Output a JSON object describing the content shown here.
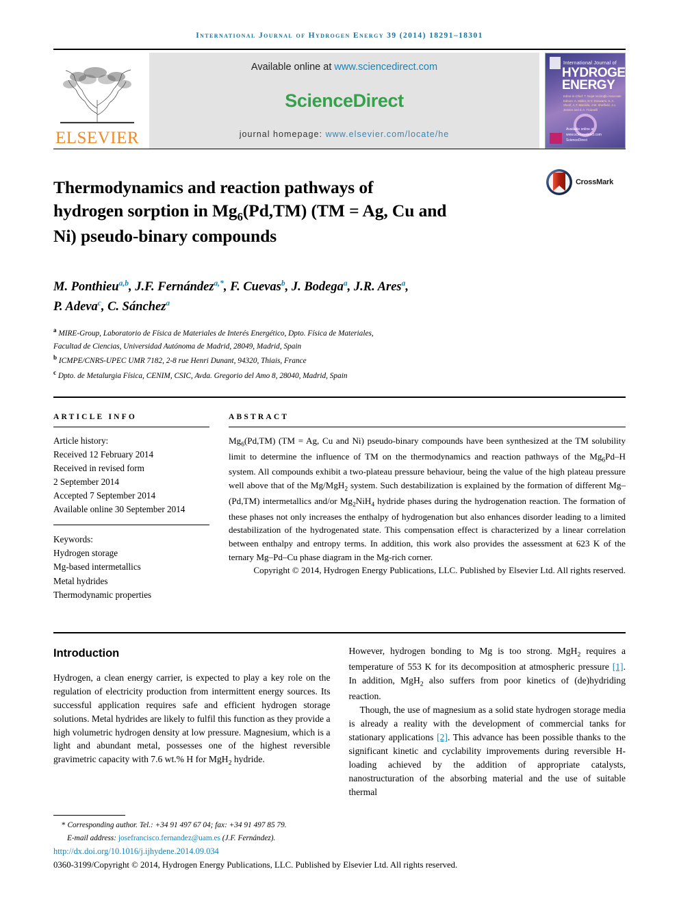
{
  "running_head": "International Journal of Hydrogen Energy 39 (2014) 18291–18301",
  "masthead": {
    "publisher": "ELSEVIER",
    "available_prefix": "Available online at ",
    "available_url": "www.sciencedirect.com",
    "sciencedirect_logo": "ScienceDirect",
    "homepage_prefix": "journal homepage: ",
    "homepage_url": "www.elsevier.com/locate/he",
    "cover": {
      "line1": "International Journal of",
      "line2": "HYDROGEN",
      "line3": "ENERGY",
      "editors": "Editor-in-Chief: T. Nejat Veziroğlu\nAssociate Editors: A. Müller, D.Y. Goswami, S. A. Sherif,\nA.T. Marolda, J.W. Sheffield,\nJ.o. Jensen and E.A. Ticianelli",
      "sciencedirect_note": "Available online at www.sciencedirect.com\nScienceDirect"
    }
  },
  "crossmark": {
    "label": "CrossMark"
  },
  "article": {
    "title_line1": "Thermodynamics and reaction pathways of",
    "title_line2_a": "hydrogen sorption in Mg",
    "title_line2_sub": "6",
    "title_line2_b": "(Pd,TM) (TM = Ag, Cu and",
    "title_line3": "Ni) pseudo-binary compounds"
  },
  "authors": {
    "list": [
      {
        "name": "M. Ponthieu",
        "sup": "a,b",
        "sep": ", "
      },
      {
        "name": "J.F. Fernández",
        "sup": "a,*",
        "sep": ", "
      },
      {
        "name": "F. Cuevas",
        "sup": "b",
        "sep": ", "
      },
      {
        "name": "J. Bodega",
        "sup": "a",
        "sep": ", "
      },
      {
        "name": "J.R. Ares",
        "sup": "a",
        "sep": ", "
      },
      {
        "name": "P. Adeva",
        "sup": "c",
        "sep": ", "
      },
      {
        "name": "C. Sánchez",
        "sup": "a",
        "sep": ""
      }
    ],
    "affiliations": [
      {
        "marker": "a",
        "text": "MIRE-Group, Laboratorio de Física de Materiales de Interés Energético, Dpto. Física de Materiales,"
      },
      {
        "marker": "",
        "text": "Facultad de Ciencias, Universidad Autónoma de Madrid, 28049, Madrid, Spain"
      },
      {
        "marker": "b",
        "text": "ICMPE/CNRS-UPEC UMR 7182, 2-8 rue Henri Dunant, 94320, Thiais, France"
      },
      {
        "marker": "c",
        "text": "Dpto. de Metalurgia Física, CENIM, CSIC, Avda. Gregorio del Amo 8, 28040, Madrid, Spain"
      }
    ]
  },
  "article_info": {
    "heading": "ARTICLE INFO",
    "history_label": "Article history:",
    "history": [
      "Received 12 February 2014",
      "Received in revised form",
      "2 September 2014",
      "Accepted 7 September 2014",
      "Available online 30 September 2014"
    ],
    "keywords_label": "Keywords:",
    "keywords": [
      "Hydrogen storage",
      "Mg-based intermetallics",
      "Metal hydrides",
      "Thermodynamic properties"
    ]
  },
  "abstract": {
    "heading": "ABSTRACT",
    "p1_a": "Mg",
    "p1_sub1": "6",
    "p1_b": "(Pd,TM) (TM = Ag, Cu and Ni) pseudo-binary compounds have been synthesized at the TM solubility limit to determine the influence of TM on the thermodynamics and reaction pathways of the Mg",
    "p1_sub2": "6",
    "p1_c": "Pd–H system. All compounds exhibit a two-plateau pressure behaviour, being the value of the high plateau pressure well above that of the Mg/MgH",
    "p1_sub3": "2",
    "p1_d": " system. Such destabilization is explained by the formation of different Mg–(Pd,TM) intermetallics and/or Mg",
    "p1_sub4": "2",
    "p1_e": "NiH",
    "p1_sub5": "4",
    "p1_f": " hydride phases during the hydrogenation reaction. The formation of these phases not only increases the enthalpy of hydrogenation but also enhances disorder leading to a limited destabilization of the hydrogenated state. This compensation effect is characterized by a linear correlation between enthalpy and entropy terms. In addition, this work also provides the assessment at 623 K of the ternary Mg–Pd–Cu phase diagram in the Mg-rich corner.",
    "copyright": "Copyright © 2014, Hydrogen Energy Publications, LLC. Published by Elsevier Ltd. All rights reserved."
  },
  "body": {
    "heading": "Introduction",
    "left_p1": "Hydrogen, a clean energy carrier, is expected to play a key role on the regulation of electricity production from intermittent energy sources. Its successful application requires safe and efficient hydrogen storage solutions. Metal hydrides are likely to fulfil this function as they provide a high volumetric hydrogen density at low pressure. Magnesium, which is a light and abundant metal, possesses one of the highest reversible gravimetric capacity with 7.6 wt.% H for MgH",
    "left_p1_sub": "2",
    "left_p1_end": " hydride.",
    "right_p1_a": "However, hydrogen bonding to Mg is too strong. MgH",
    "right_p1_sub1": "2",
    "right_p1_b": " requires a temperature of 553 K for its decomposition at atmospheric pressure ",
    "right_p1_ref1": "[1]",
    "right_p1_c": ". In addition, MgH",
    "right_p1_sub2": "2",
    "right_p1_d": " also suffers from poor kinetics of (de)hydriding reaction.",
    "right_p2_a": "Though, the use of magnesium as a solid state hydrogen storage media is already a reality with the development of commercial tanks for stationary applications ",
    "right_p2_ref2": "[2]",
    "right_p2_b": ". This advance has been possible thanks to the significant kinetic and cyclability improvements during reversible H-loading achieved by the addition of appropriate catalysts, nanostructuration of the absorbing material and the use of suitable thermal"
  },
  "footer": {
    "corresponding_star": "*",
    "corresponding": " Corresponding author. Tel.: +34 91 497 67 04; fax: +34 91 497 85 79.",
    "email_label": "E-mail address: ",
    "email": "josefrancisco.fernandez@uam.es",
    "email_suffix": " (J.F. Fernández).",
    "doi": "http://dx.doi.org/10.1016/j.ijhydene.2014.09.034",
    "issn": "0360-3199/Copyright © 2014, Hydrogen Energy Publications, LLC. Published by Elsevier Ltd. All rights reserved."
  },
  "colors": {
    "accent_blue": "#1673a0",
    "link_blue": "#1b81b5",
    "sciencedirect_green": "#36a04a",
    "elsevier_orange": "#f08a24",
    "crossmark_red": "#c0392b",
    "crossmark_navy": "#1f3864"
  }
}
